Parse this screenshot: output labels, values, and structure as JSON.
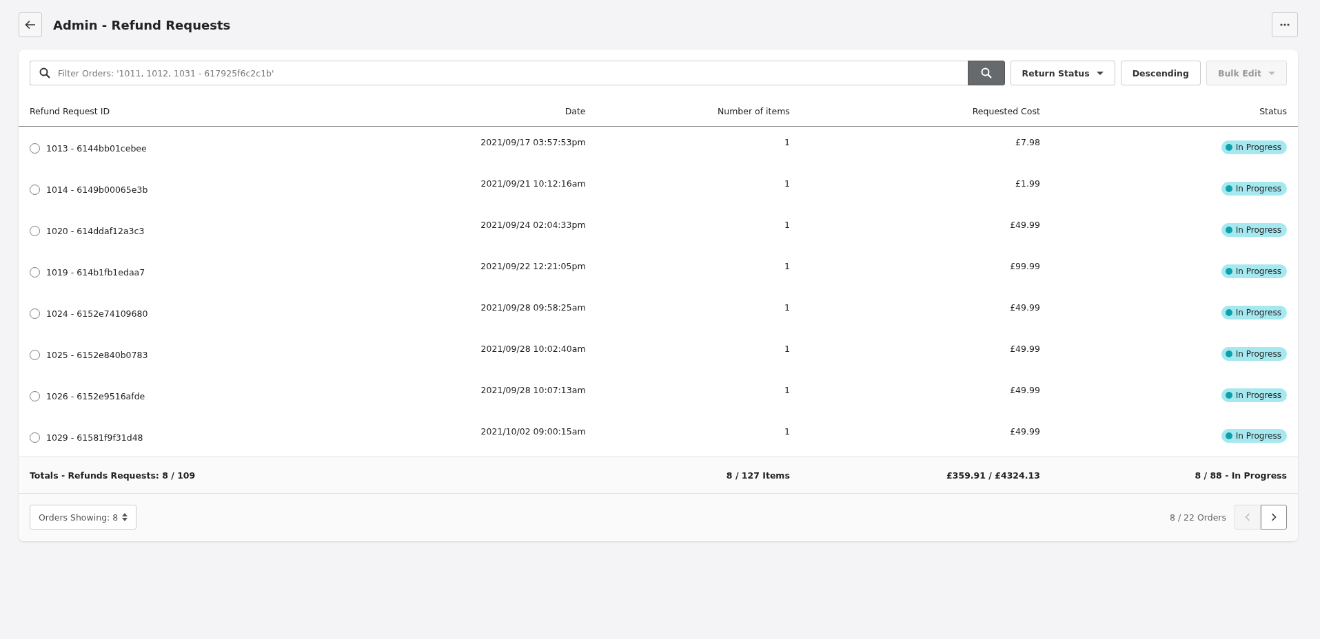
{
  "header": {
    "title": "Admin - Refund Requests"
  },
  "toolbar": {
    "search": {
      "placeholder": "Filter Orders: '1011, 1012, 1031 - 617925f6c2c1b'"
    },
    "buttons": [
      {
        "kind": "dropdown",
        "label": "Return Status",
        "disabled": false
      },
      {
        "kind": "plain",
        "label": "Descending",
        "disabled": false
      },
      {
        "kind": "dropdown",
        "label": "Bulk Edit",
        "disabled": true
      }
    ]
  },
  "table": {
    "columns": [
      "Refund Request ID",
      "Date",
      "Number of items",
      "Requested Cost",
      "Status"
    ],
    "rows": [
      {
        "id": "1013 - 6144bb01cebee",
        "date": "2021/09/17 03:57:53pm",
        "items": "1",
        "cost": "£7.98",
        "status": "In Progress",
        "selected": false
      },
      {
        "id": "1014 - 6149b00065e3b",
        "date": "2021/09/21 10:12:16am",
        "items": "1",
        "cost": "£1.99",
        "status": "In Progress",
        "selected": false
      },
      {
        "id": "1020 - 614ddaf12a3c3",
        "date": "2021/09/24 02:04:33pm",
        "items": "1",
        "cost": "£49.99",
        "status": "In Progress",
        "selected": false
      },
      {
        "id": "1019 - 614b1fb1edaa7",
        "date": "2021/09/22 12:21:05pm",
        "items": "1",
        "cost": "£99.99",
        "status": "In Progress",
        "selected": false
      },
      {
        "id": "1024 - 6152e74109680",
        "date": "2021/09/28 09:58:25am",
        "items": "1",
        "cost": "£49.99",
        "status": "In Progress",
        "selected": false
      },
      {
        "id": "1025 - 6152e840b0783",
        "date": "2021/09/28 10:02:40am",
        "items": "1",
        "cost": "£49.99",
        "status": "In Progress",
        "selected": false
      },
      {
        "id": "1026 - 6152e9516afde",
        "date": "2021/09/28 10:07:13am",
        "items": "1",
        "cost": "£49.99",
        "status": "In Progress",
        "selected": false
      },
      {
        "id": "1029 - 61581f9f31d48",
        "date": "2021/10/02 09:00:15am",
        "items": "1",
        "cost": "£49.99",
        "status": "In Progress",
        "selected": false
      }
    ],
    "totals": {
      "label": "Totals - Refunds Requests: 8 / 109",
      "items": "8 / 127 Items",
      "cost": "£359.91 / £4324.13",
      "status": "8 / 88 - In Progress"
    }
  },
  "footer": {
    "page_size": "Orders Showing: 8",
    "count": "8 / 22 Orders",
    "prev_disabled": true,
    "next_disabled": false
  }
}
